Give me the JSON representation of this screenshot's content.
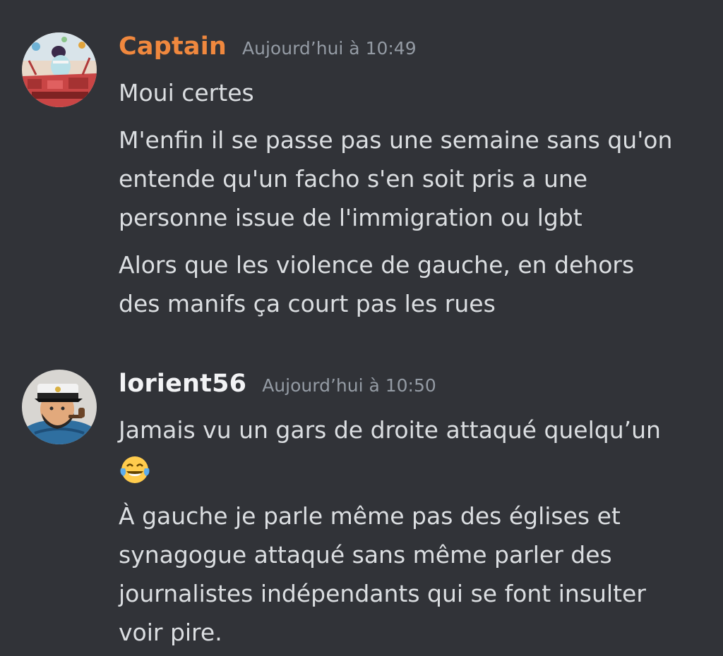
{
  "messages": [
    {
      "username": "Captain",
      "username_color": "#f0883e",
      "timestamp": "Aujourd’hui à 10:49",
      "avatar_icon": "captain-avatar",
      "lines": [
        "Moui certes",
        "M'enfin il se passe pas une semaine sans qu'on\nentende qu'un facho s'en soit pris a une\npersonne issue de l'immigration ou lgbt",
        "Alors que les violence de gauche, en dehors\ndes manifs ça court pas les rues"
      ]
    },
    {
      "username": "lorient56",
      "username_color": "#f2f3f5",
      "timestamp": "Aujourd’hui à 10:50",
      "avatar_icon": "sailor-captain-avatar",
      "lines": [
        "Jamais vu un gars de droite attaqué quelqu’un",
        "🤣",
        "À gauche je parle même pas des églises et\nsynagogue attaqué sans même parler des\njournalistes indépendants qui se font insulter\nvoir pire."
      ],
      "emoji_icon": "face-with-tears-of-joy-icon"
    }
  ]
}
